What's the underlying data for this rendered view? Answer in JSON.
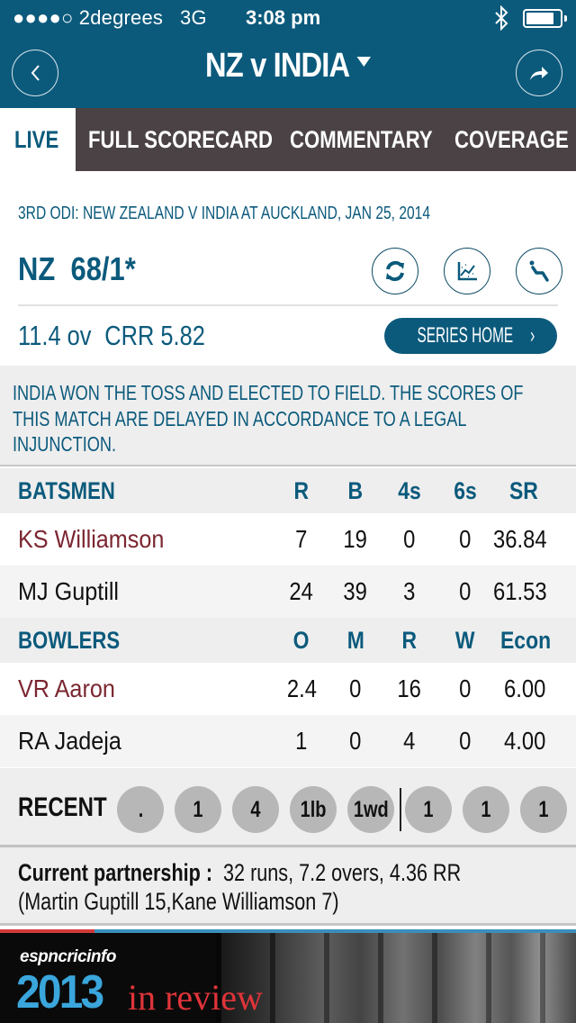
{
  "status_bar": {
    "signal": "●●●●○",
    "carrier": "2degrees",
    "network": "3G",
    "time": "3:08 pm",
    "bluetooth_icon": "bluetooth-icon",
    "battery_icon": "battery-icon",
    "battery_level": 0.75
  },
  "header": {
    "title": "NZ v INDIA",
    "back_icon": "chevron-left-icon",
    "share_icon": "share-arrow-icon",
    "title_dropdown_icon": "caret-down-icon"
  },
  "tabs": [
    {
      "label": "LIVE",
      "active": true
    },
    {
      "label": "FULL SCORECARD",
      "active": false
    },
    {
      "label": "COMMENTARY",
      "active": false
    },
    {
      "label": "COVERAGE",
      "active": false
    }
  ],
  "match": {
    "title": "3RD ODI: NEW ZEALAND V INDIA AT AUCKLAND, JAN 25, 2014",
    "team": "NZ",
    "score": "68/1*",
    "overs": "11.4 ov",
    "crr": "CRR 5.82",
    "series_home_label": "SERIES HOME",
    "actions": [
      {
        "icon": "refresh-icon"
      },
      {
        "icon": "graph-icon"
      },
      {
        "icon": "player-stats-icon"
      }
    ]
  },
  "notice": "INDIA WON THE TOSS AND ELECTED TO FIELD. THE SCORES OF THIS MATCH ARE DELAYED IN ACCORDANCE TO A LEGAL INJUNCTION.",
  "batsmen": {
    "header": [
      "BATSMEN",
      "R",
      "B",
      "4s",
      "6s",
      "SR"
    ],
    "rows": [
      {
        "name": "KS Williamson",
        "r": "7",
        "b": "19",
        "fours": "0",
        "sixes": "0",
        "sr": "36.84",
        "on_strike": true
      },
      {
        "name": "MJ Guptill",
        "r": "24",
        "b": "39",
        "fours": "3",
        "sixes": "0",
        "sr": "61.53",
        "on_strike": false
      }
    ]
  },
  "bowlers": {
    "header": [
      "BOWLERS",
      "O",
      "M",
      "R",
      "W",
      "Econ"
    ],
    "rows": [
      {
        "name": "VR Aaron",
        "o": "2.4",
        "m": "0",
        "r": "16",
        "w": "0",
        "econ": "6.00",
        "current": true
      },
      {
        "name": "RA Jadeja",
        "o": "1",
        "m": "0",
        "r": "4",
        "w": "0",
        "econ": "4.00",
        "current": false
      }
    ]
  },
  "recent": {
    "label": "RECENT",
    "balls": [
      ".",
      "1",
      "4",
      "1lb",
      "1wd",
      "1",
      "1",
      "1"
    ]
  },
  "partnership": {
    "label": "Current partnership :",
    "summary": "32 runs, 7.2 overs, 4.36 RR",
    "detail": "(Martin Guptill 15,Kane Williamson 7)"
  },
  "banner": {
    "brand": "espncricinfo",
    "year": "2013",
    "text": "in review"
  },
  "colors": {
    "primary": "#0b5a7c",
    "tab_bar": "#4a4244",
    "highlight_name": "#7b2630",
    "ball_bg": "#b8b7b8"
  }
}
